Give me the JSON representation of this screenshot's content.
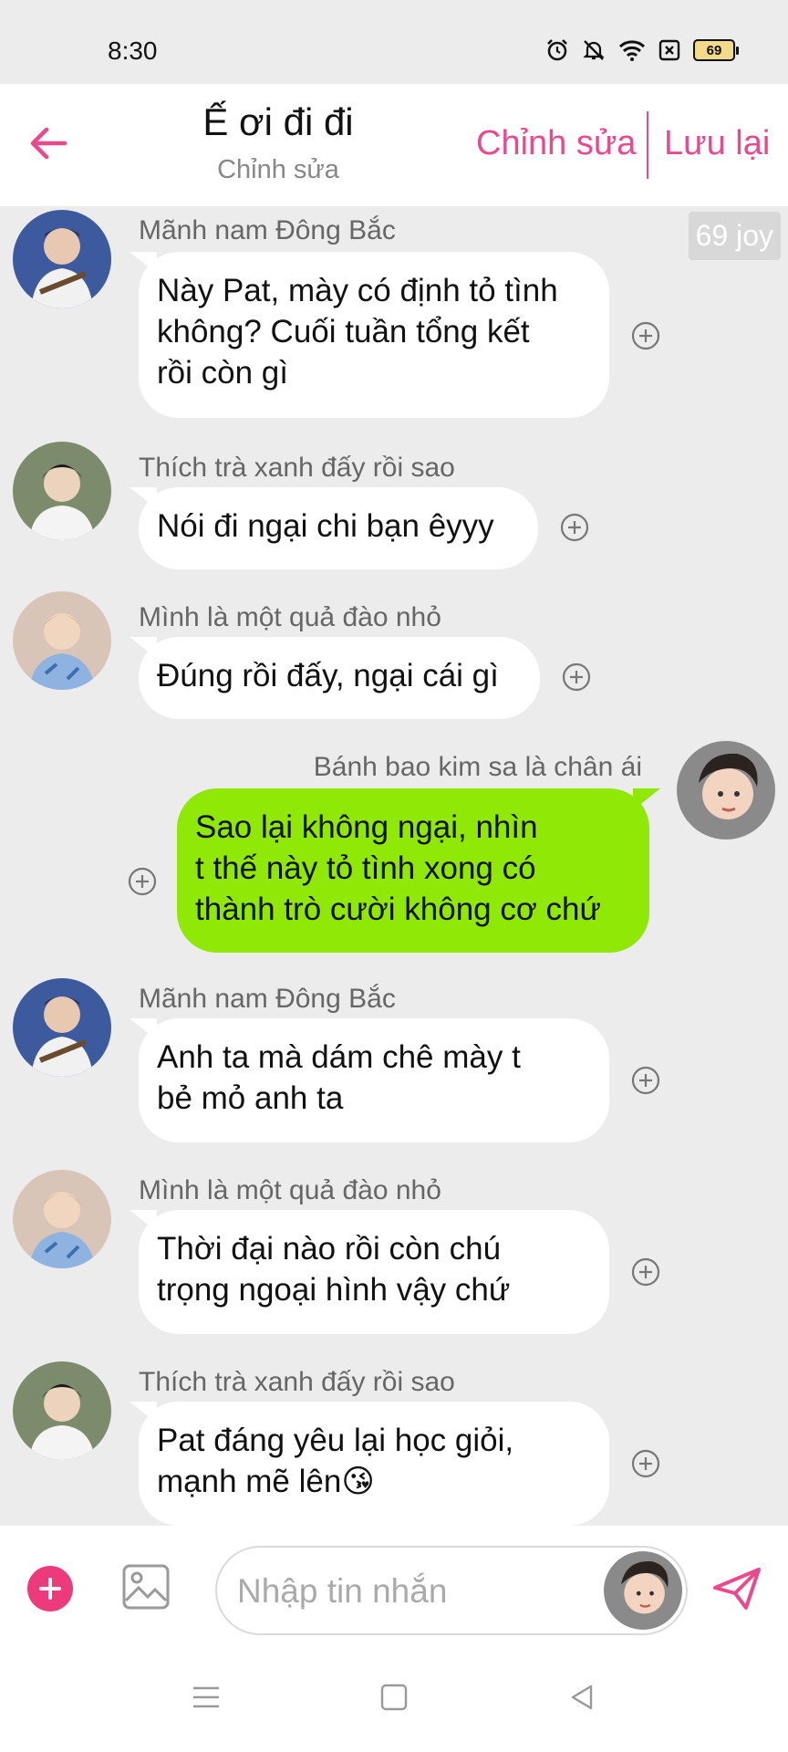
{
  "status_bar": {
    "time": "8:30",
    "battery": "69",
    "icons": [
      "alarm-icon",
      "mute-icon",
      "wifi-icon",
      "sim-icon",
      "battery-icon"
    ]
  },
  "header": {
    "title": "Ế ơi đi đi",
    "subtitle": "Chỉnh sửa",
    "edit_label": "Chỉnh sửa",
    "save_label": "Lưu lại",
    "accent_color": "#e84a8d"
  },
  "badge": "69 joy",
  "messages": [
    {
      "sender": "Mãnh nam Đông Bắc",
      "lines": [
        "Này Pat, mày có định tỏ tình",
        "không? Cuối tuần tổng kết",
        "rồi còn gì"
      ],
      "mine": false
    },
    {
      "sender": "Thích trà xanh đấy rồi sao",
      "lines": [
        "Nói đi ngại chi bạn êyyy"
      ],
      "mine": false
    },
    {
      "sender": "Mình là một quả đào nhỏ",
      "lines": [
        "Đúng rồi đấy, ngại cái gì"
      ],
      "mine": false
    },
    {
      "sender": "Bánh bao kim sa là chân ái",
      "lines": [
        "Sao lại không ngại, nhìn",
        "t thế này tỏ tình xong có",
        "thành trò cười không cơ chứ"
      ],
      "mine": true
    },
    {
      "sender": "Mãnh nam Đông Bắc",
      "lines": [
        "Anh ta mà dám chê mày t",
        "bẻ mỏ anh ta"
      ],
      "mine": false
    },
    {
      "sender": "Mình là một quả đào nhỏ",
      "lines": [
        "Thời đại nào rồi còn chú",
        "trọng ngoại hình vậy chứ"
      ],
      "mine": false
    },
    {
      "sender": "Thích trà xanh đấy rồi sao",
      "lines": [
        "Pat đáng yêu lại học giỏi,",
        "mạnh mẽ lên😘"
      ],
      "mine": false
    }
  ],
  "input": {
    "placeholder": "Nhập tin nhắn",
    "value": ""
  },
  "colors": {
    "mine_bubble": "#8fe806",
    "plus_button": "#ec3a7d"
  }
}
